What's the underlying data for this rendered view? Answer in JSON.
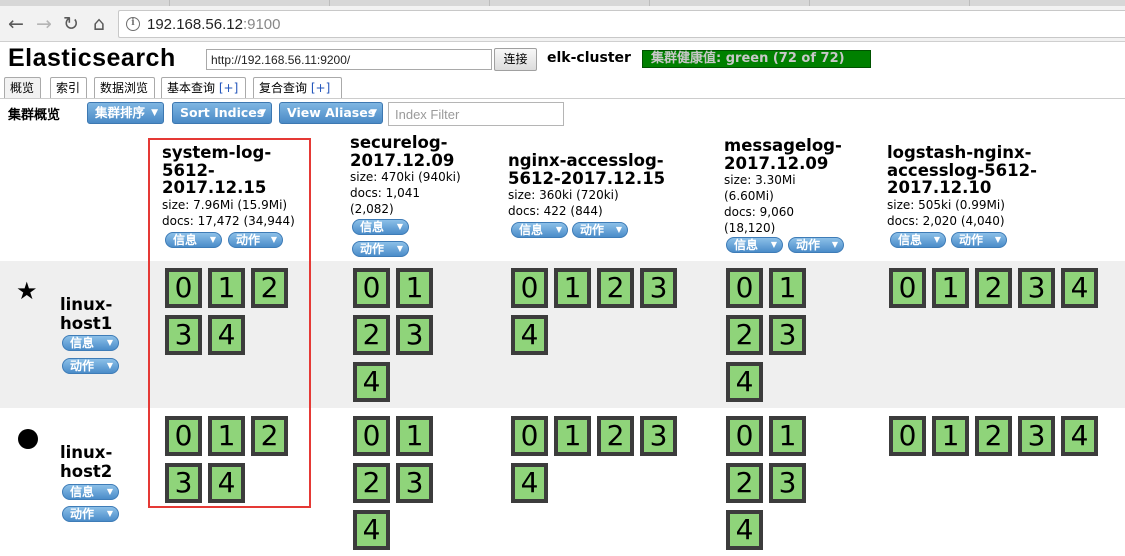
{
  "browser": {
    "url_host": "192.168.56.12",
    "url_port": ":9100",
    "back_icon": "arrow-left-icon",
    "forward_icon": "arrow-right-icon",
    "reload_icon": "reload-icon",
    "home_icon": "home-icon"
  },
  "app": {
    "title": "Elasticsearch",
    "connect_url": "http://192.168.56.11:9200/",
    "connect_label": "连接",
    "cluster_name": "elk-cluster",
    "health": "集群健康值: green (72 of 72)",
    "health_color": "#008000"
  },
  "tabs": [
    {
      "label": "概览",
      "plus": ""
    },
    {
      "label": "索引",
      "plus": ""
    },
    {
      "label": "数据浏览",
      "plus": ""
    },
    {
      "label": "基本查询 ",
      "plus": "[+]"
    },
    {
      "label": "复合查询 ",
      "plus": "[+]"
    }
  ],
  "toolbar": {
    "title": "集群概览",
    "sort_cluster": "集群排序",
    "sort_indices": "Sort Indices",
    "view_aliases": "View Aliases",
    "filter_placeholder": "Index Filter"
  },
  "pills": {
    "info": "信息",
    "action": "动作"
  },
  "indices": [
    {
      "name": [
        "system-log-",
        "5612-",
        "2017.12.15"
      ],
      "meta": [
        "size: 7.96Mi (15.9Mi)",
        "docs: 17,472 (34,944)"
      ],
      "shards": [
        "0",
        "1",
        "2",
        "3",
        "4"
      ]
    },
    {
      "name": [
        "securelog-",
        "2017.12.09"
      ],
      "meta": [
        "size: 470ki (940ki)",
        "docs: 1,041",
        "(2,082)"
      ],
      "shards": [
        "0",
        "1",
        "2",
        "3",
        "4"
      ]
    },
    {
      "name": [
        "nginx-accesslog-",
        "5612-2017.12.15"
      ],
      "meta": [
        "size: 360ki (720ki)",
        "docs: 422 (844)"
      ],
      "shards": [
        "0",
        "1",
        "2",
        "3",
        "4"
      ]
    },
    {
      "name": [
        "messagelog-",
        "2017.12.09"
      ],
      "meta": [
        "size: 3.30Mi",
        "(6.60Mi)",
        "docs: 9,060",
        "(18,120)"
      ],
      "shards": [
        "0",
        "1",
        "2",
        "3",
        "4"
      ]
    },
    {
      "name": [
        "logstash-nginx-",
        "accesslog-5612-",
        "2017.12.10"
      ],
      "meta": [
        "size: 505ki (0.99Mi)",
        "docs: 2,020 (4,040)"
      ],
      "shards": [
        "0",
        "1",
        "2",
        "3",
        "4"
      ]
    }
  ],
  "nodes": [
    {
      "name": [
        "linux-",
        "host1"
      ],
      "marker": "star-icon",
      "marker_glyph": "★"
    },
    {
      "name": [
        "linux-",
        "host2"
      ],
      "marker": "dot-icon",
      "marker_glyph": ""
    }
  ],
  "colors": {
    "shard_fill": "#8fd47a",
    "shard_border": "#3c3c3c",
    "button_blue": "#4a8ac6",
    "row_band": "#efefef",
    "highlight": "#e53935"
  }
}
